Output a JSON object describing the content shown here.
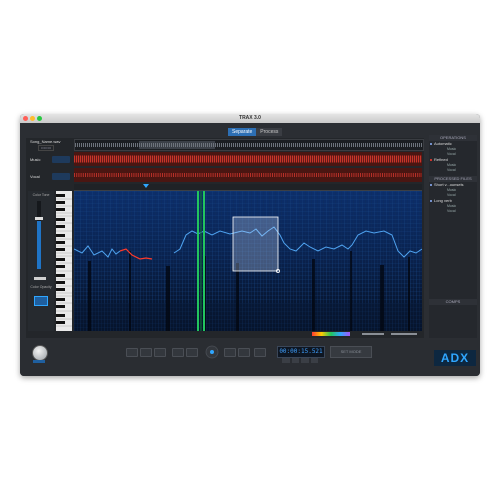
{
  "window": {
    "title": "TRAX 3.0"
  },
  "tabs": [
    {
      "label": "Separate"
    },
    {
      "label": "Process"
    }
  ],
  "tracks": {
    "file_name": "Song_Name.wav",
    "file_sub": "0:00:00",
    "rows": [
      {
        "label": "Music"
      },
      {
        "label": "Vocal"
      }
    ]
  },
  "left_panel": {
    "contrast_label": "Color Tone",
    "opacity_label": "Color Opacity"
  },
  "right_panel": {
    "operations_header": "OPERATIONS",
    "operations": [
      {
        "label": "Automatic",
        "color": "#8fb3ff",
        "subs": [
          "Music",
          "Vocal"
        ]
      },
      {
        "label": "Refined",
        "color": "#ff3b30",
        "subs": [
          "Music",
          "Vocal"
        ]
      }
    ],
    "processed_header": "PROCESSED FILES",
    "processed": [
      {
        "label": "Short v...ounsels",
        "color": "#8fb3ff",
        "subs": [
          "Music",
          "Vocal"
        ]
      },
      {
        "label": "Long verb",
        "color": "#8fb3ff",
        "subs": [
          "Music",
          "Vocal"
        ]
      }
    ],
    "footer": "COMPS"
  },
  "transport": {
    "timecode": "00:00:15.521",
    "export_label": "SET MODE"
  },
  "brand": {
    "logo": "ADX",
    "accent": "#2fa6ff"
  }
}
